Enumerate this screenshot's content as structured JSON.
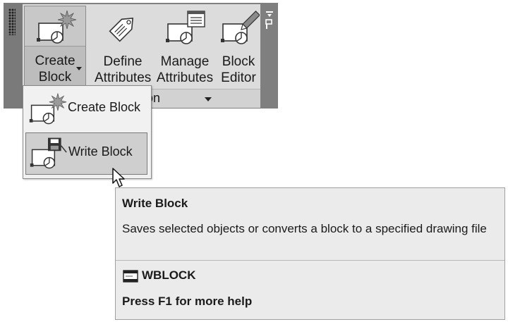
{
  "ribbon": {
    "buttons": [
      {
        "line1": "Create",
        "line2": "Block"
      },
      {
        "line1": "Define",
        "line2": "Attributes"
      },
      {
        "line1": "Manage",
        "line2": "Attributes"
      },
      {
        "line1": "Block",
        "line2": "Editor"
      }
    ],
    "panel_label": "ition",
    "icons": [
      "create-block-icon",
      "define-attributes-icon",
      "manage-attributes-icon",
      "block-editor-icon",
      "pin-icon"
    ]
  },
  "menu": {
    "items": [
      {
        "label": "Create Block",
        "icon": "create-block-icon"
      },
      {
        "label": "Write Block",
        "icon": "write-block-icon"
      }
    ]
  },
  "tooltip": {
    "title": "Write Block",
    "description": "Saves selected objects or converts a block to a specified drawing file",
    "command": "WBLOCK",
    "help": "Press F1 for more help"
  },
  "colors": {
    "panel_frame": "#7f7f7f",
    "panel_body": "#dcdcdc",
    "tooltip_bg": "#ebebeb",
    "menu_hover": "#cfcfcf"
  }
}
